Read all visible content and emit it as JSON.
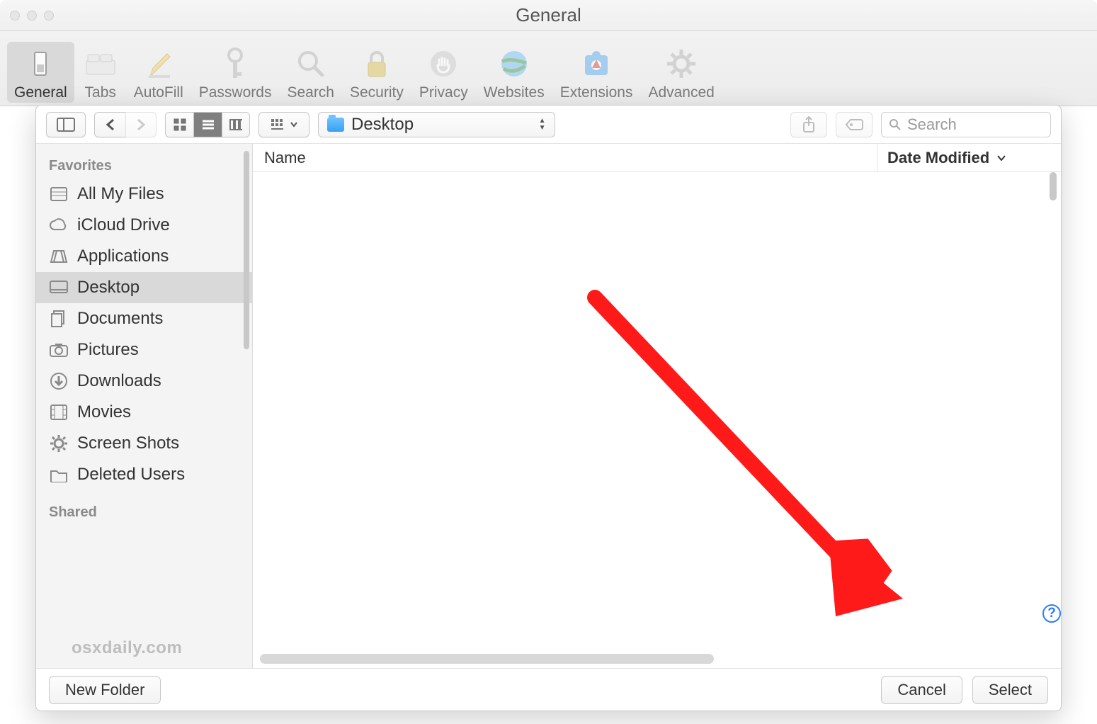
{
  "window": {
    "title": "General"
  },
  "prefs_tabs": [
    {
      "label": "General",
      "selected": true,
      "icon": "switch"
    },
    {
      "label": "Tabs",
      "selected": false,
      "icon": "tabs"
    },
    {
      "label": "AutoFill",
      "selected": false,
      "icon": "pencil"
    },
    {
      "label": "Passwords",
      "selected": false,
      "icon": "key"
    },
    {
      "label": "Search",
      "selected": false,
      "icon": "magnify"
    },
    {
      "label": "Security",
      "selected": false,
      "icon": "lock"
    },
    {
      "label": "Privacy",
      "selected": false,
      "icon": "hand"
    },
    {
      "label": "Websites",
      "selected": false,
      "icon": "globe"
    },
    {
      "label": "Extensions",
      "selected": false,
      "icon": "puzzle"
    },
    {
      "label": "Advanced",
      "selected": false,
      "icon": "gear"
    }
  ],
  "sheet": {
    "path_label": "Desktop",
    "search_placeholder": "Search",
    "columns": {
      "name": "Name",
      "date": "Date Modified"
    },
    "footer": {
      "new_folder": "New Folder",
      "cancel": "Cancel",
      "select": "Select"
    },
    "help": "?"
  },
  "sidebar": {
    "favorites_label": "Favorites",
    "shared_label": "Shared",
    "items": [
      {
        "label": "All My Files",
        "icon": "allfiles",
        "selected": false
      },
      {
        "label": "iCloud Drive",
        "icon": "cloud",
        "selected": false
      },
      {
        "label": "Applications",
        "icon": "apps",
        "selected": false
      },
      {
        "label": "Desktop",
        "icon": "desktop",
        "selected": true
      },
      {
        "label": "Documents",
        "icon": "docs",
        "selected": false
      },
      {
        "label": "Pictures",
        "icon": "pictures",
        "selected": false
      },
      {
        "label": "Downloads",
        "icon": "download",
        "selected": false
      },
      {
        "label": "Movies",
        "icon": "movies",
        "selected": false
      },
      {
        "label": "Screen Shots",
        "icon": "gear",
        "selected": false
      },
      {
        "label": "Deleted Users",
        "icon": "folder",
        "selected": false
      }
    ]
  },
  "watermark": "osxdaily.com"
}
